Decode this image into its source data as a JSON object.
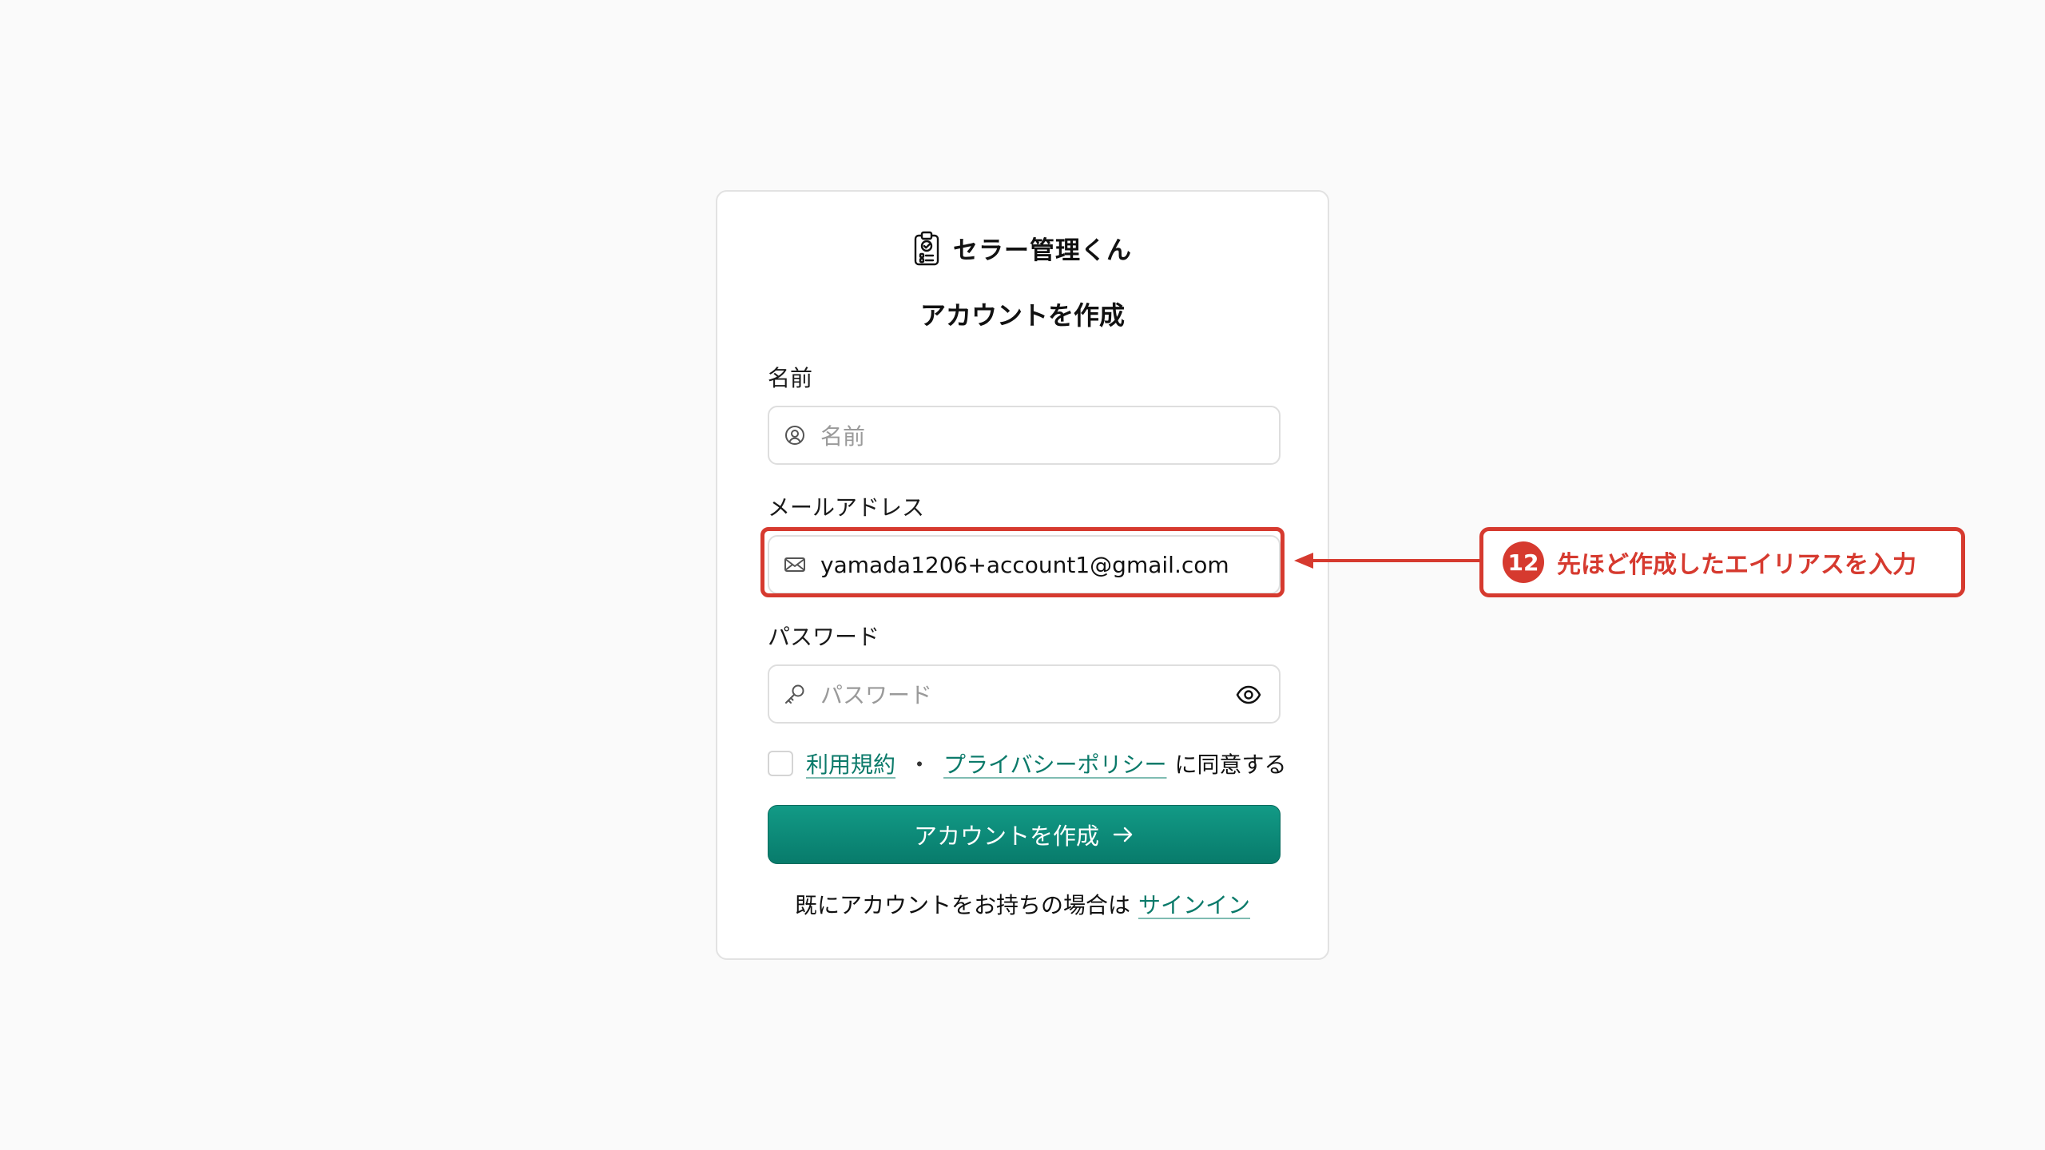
{
  "brand": {
    "name": "セラー管理くん",
    "icon": "clipboard-check-icon"
  },
  "form": {
    "title": "アカウントを作成",
    "name": {
      "label": "名前",
      "placeholder": "名前",
      "value": "",
      "icon": "user-circle-icon"
    },
    "email": {
      "label": "メールアドレス",
      "placeholder": "",
      "value": "yamada1206+account1@gmail.com",
      "icon": "mail-icon"
    },
    "password": {
      "label": "パスワード",
      "placeholder": "パスワード",
      "value": "",
      "icon": "key-icon",
      "toggle_icon": "eye-icon"
    },
    "terms": {
      "checked": false,
      "terms_link": "利用規約",
      "separator": "・",
      "privacy_link": "プライバシーポリシー",
      "agree_text": "に同意する"
    },
    "submit_label": "アカウントを作成",
    "signin_prompt": "既にアカウントをお持ちの場合は",
    "signin_link": "サインイン"
  },
  "annotation": {
    "step_number": "12",
    "text": "先ほど作成したエイリアスを入力",
    "color": "#d63a2f"
  },
  "colors": {
    "accent": "#0b7a6a",
    "button": "#0a8a78",
    "background": "#fafafa"
  }
}
